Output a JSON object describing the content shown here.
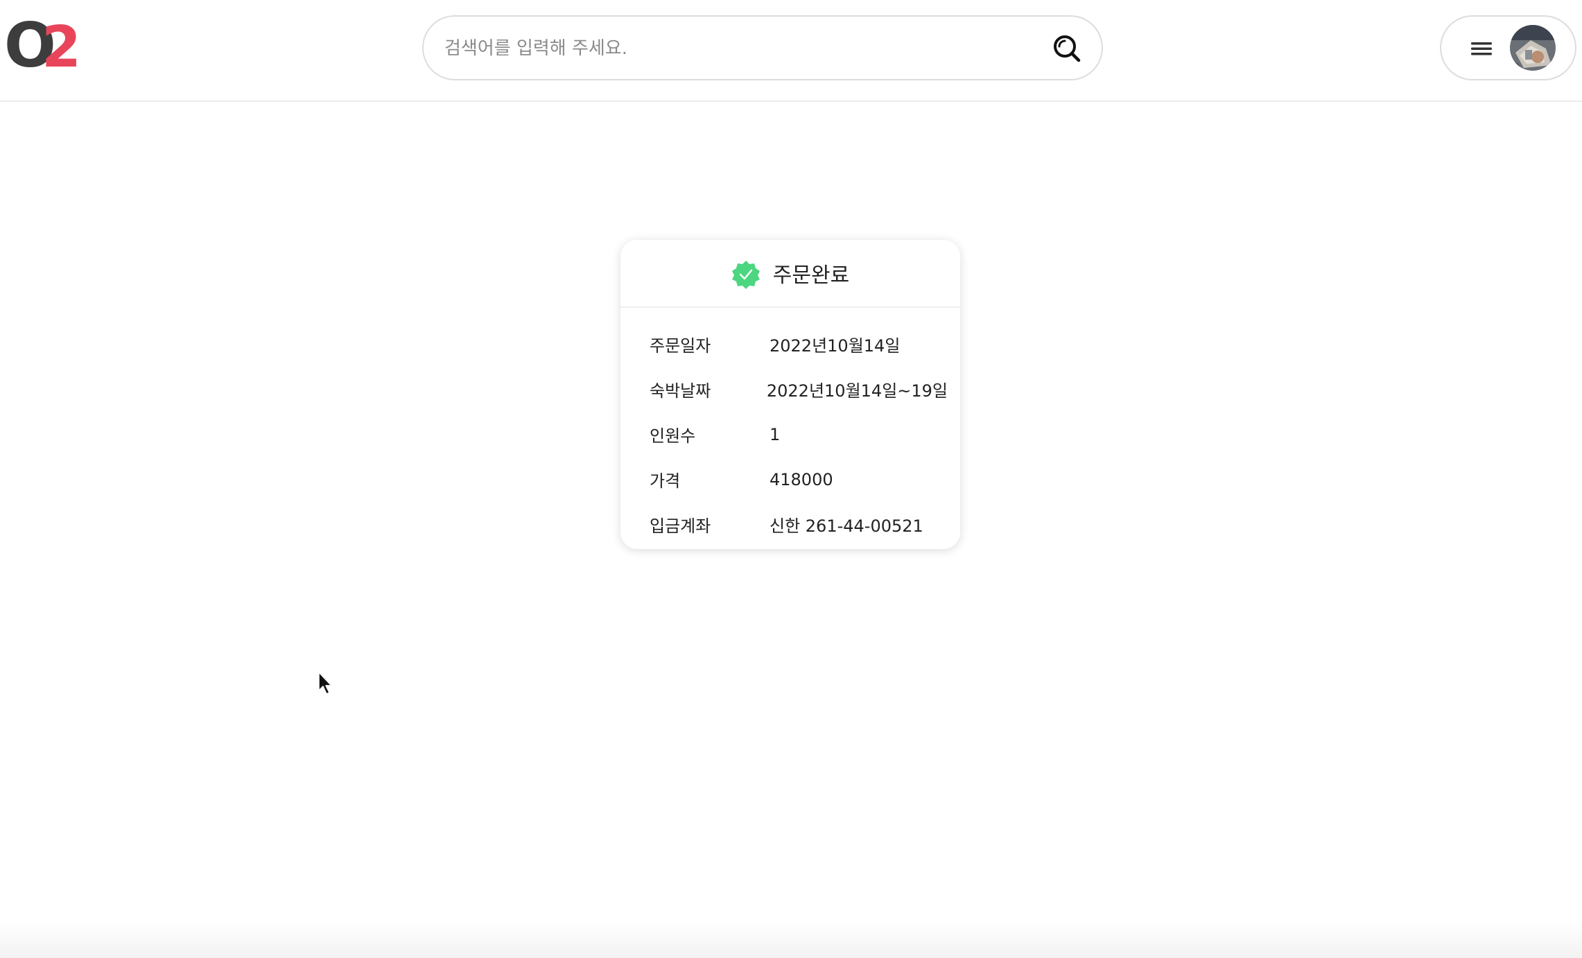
{
  "header": {
    "logo": {
      "text_o": "O",
      "text_2": "2",
      "colors": {
        "o": "#3d3d3d",
        "two": "#e8455a"
      }
    },
    "search": {
      "placeholder": "검색어를 입력해 주세요.",
      "value": "",
      "icon": "search-icon"
    },
    "user_menu": {
      "menu_icon": "hamburger-menu-icon",
      "avatar": "user-avatar"
    }
  },
  "order": {
    "title": "주문완료",
    "status_icon": "verified-badge-icon",
    "accent_color": "#4cd680",
    "rows": [
      {
        "label": "주문일자",
        "value": "2022년10월14일"
      },
      {
        "label": "숙박날짜",
        "value": "2022년10월14일~19일"
      },
      {
        "label": "인원수",
        "value": "1"
      },
      {
        "label": "가격",
        "value": "418000"
      },
      {
        "label": "입금계좌",
        "value": "신한 261-44-00521"
      }
    ]
  }
}
